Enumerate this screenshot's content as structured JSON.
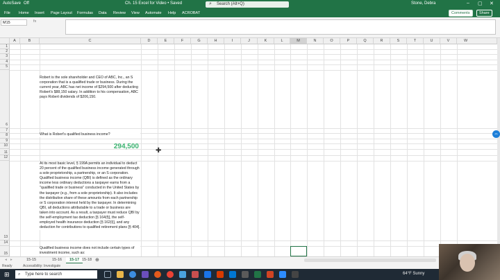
{
  "titlebar": {
    "autosave": "AutoSave",
    "autosave_state": "Off",
    "doc_title": "Ch. 15 Excel for Video • Saved",
    "search_placeholder": "Search (Alt+Q)",
    "user": "Stone, Debra"
  },
  "ribbon": {
    "tabs": [
      "File",
      "Home",
      "Insert",
      "Page Layout",
      "Formulas",
      "Data",
      "Review",
      "View",
      "Automate",
      "Help",
      "ACROBAT"
    ],
    "comments": "Comments",
    "share": "Share"
  },
  "formula_bar": {
    "name_box": "M15",
    "fx": "fx",
    "value": ""
  },
  "columns": [
    "A",
    "B",
    "C",
    "D",
    "E",
    "F",
    "G",
    "H",
    "I",
    "J",
    "K",
    "L",
    "M",
    "N",
    "O",
    "P",
    "Q",
    "R",
    "S",
    "T",
    "U",
    "V",
    "W"
  ],
  "rows": [
    "1",
    "2",
    "3",
    "4",
    "5",
    "6",
    "7",
    "8",
    "9",
    "10",
    "11",
    "12",
    "13",
    "14",
    "15"
  ],
  "cells": {
    "c6": "Robert is the sole shareholder and CEO of ABC, Inc., an S corporation that is a qualified trade or business. During the current year, ABC has net income of $294,500 after deducting Robert's $88,150 salary. In addition to his compensation, ABC pays Robert dividends of $206,150.",
    "c9": "What is Robert's qualified business income?",
    "c11": "294,500",
    "c13": "At its most basic level, § 199A permits an individual to deduct 20 percent of the qualified business income generated through a sole proprietorship, a partnership, or an S corporation. Qualified business income (QBI) is defined as the ordinary income less ordinary deductions a taxpayer earns from a \"qualified trade or business\" conducted in the United States by the taxpayer (e.g., from a sole proprietorship). It also includes the distributive share of these amounts from each partnership or S corporation interest held by the taxpayer. In determining QBI, all deductions attributable to a trade or business are taken into account. As a result, a taxpayer must reduce QBI by the self-employment tax deduction [§ 164(f)], the self-employed health insurance deduction [§ 162(l)], and any deduction for contributions to qualified retirement plans [§ 404].",
    "c15": "Qualified business income does not include certain types of investment income, such as:"
  },
  "sheet_tabs": [
    "15-15",
    "15-16",
    "15-17",
    "15-18"
  ],
  "active_sheet": "15-17",
  "status": {
    "ready": "Ready",
    "accessibility": "Accessibility: Investigate"
  },
  "taskbar": {
    "search_placeholder": "Type here to search",
    "weather": "64°F Sunny"
  },
  "colors": {
    "excel_green": "#217346",
    "answer_green": "#3cb371"
  }
}
